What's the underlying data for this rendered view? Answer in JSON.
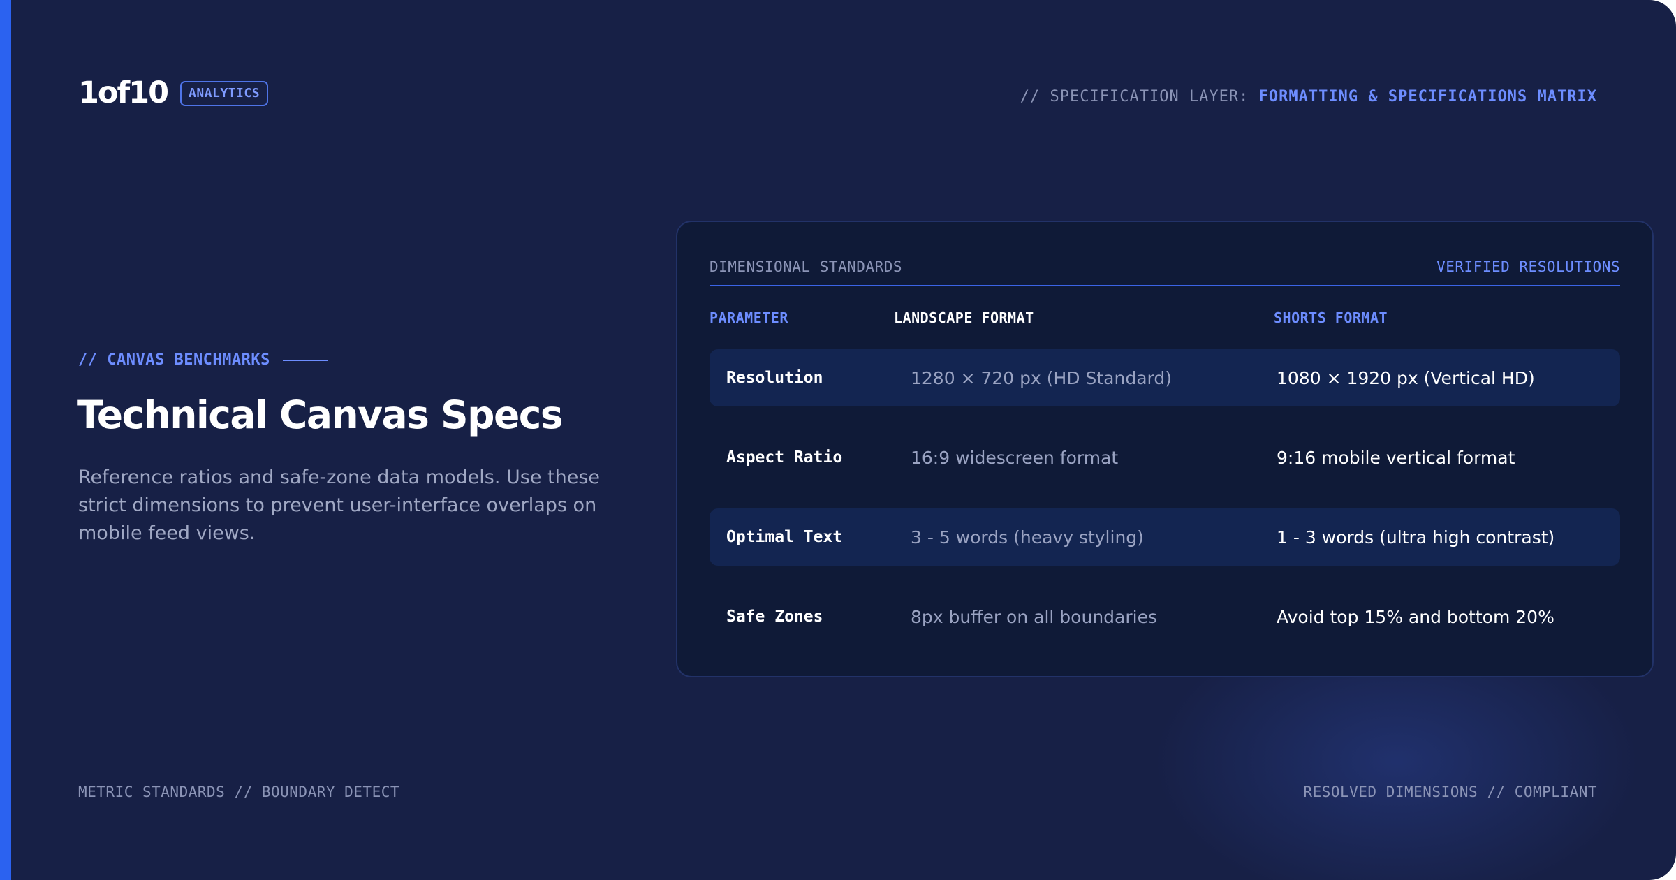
{
  "brand": {
    "logo": "1of10",
    "badge": "ANALYTICS"
  },
  "header": {
    "spec_prefix": "// SPECIFICATION LAYER:",
    "spec_value": "FORMATTING & SPECIFICATIONS MATRIX"
  },
  "intro": {
    "eyebrow": "// CANVAS BENCHMARKS",
    "title": "Technical Canvas Specs",
    "description": "Reference ratios and safe-zone data models. Use these strict dimensions to prevent user-interface overlaps on mobile feed views."
  },
  "card": {
    "label_left": "DIMENSIONAL STANDARDS",
    "label_right": "VERIFIED RESOLUTIONS",
    "columns": [
      "PARAMETER",
      "LANDSCAPE FORMAT",
      "SHORTS FORMAT"
    ],
    "rows": [
      {
        "parameter": "Resolution",
        "landscape": "1280 × 720 px (HD Standard)",
        "shorts": "1080 × 1920 px (Vertical HD)"
      },
      {
        "parameter": "Aspect Ratio",
        "landscape": "16:9 widescreen format",
        "shorts": "9:16 mobile vertical format"
      },
      {
        "parameter": "Optimal Text",
        "landscape": "3 - 5 words (heavy styling)",
        "shorts": "1 - 3 words (ultra high contrast)"
      },
      {
        "parameter": "Safe Zones",
        "landscape": "8px buffer on all boundaries",
        "shorts": "Avoid top 15% and bottom 20%"
      }
    ]
  },
  "footer": {
    "left": "METRIC STANDARDS // BOUNDARY DETECT",
    "right": "RESOLVED DIMENSIONS // COMPLIANT"
  },
  "colors": {
    "background": "#172046",
    "accent": "#2b62f0",
    "highlight": "#6d8dff",
    "card": "#0f1a37",
    "row_shaded": "#132551"
  }
}
